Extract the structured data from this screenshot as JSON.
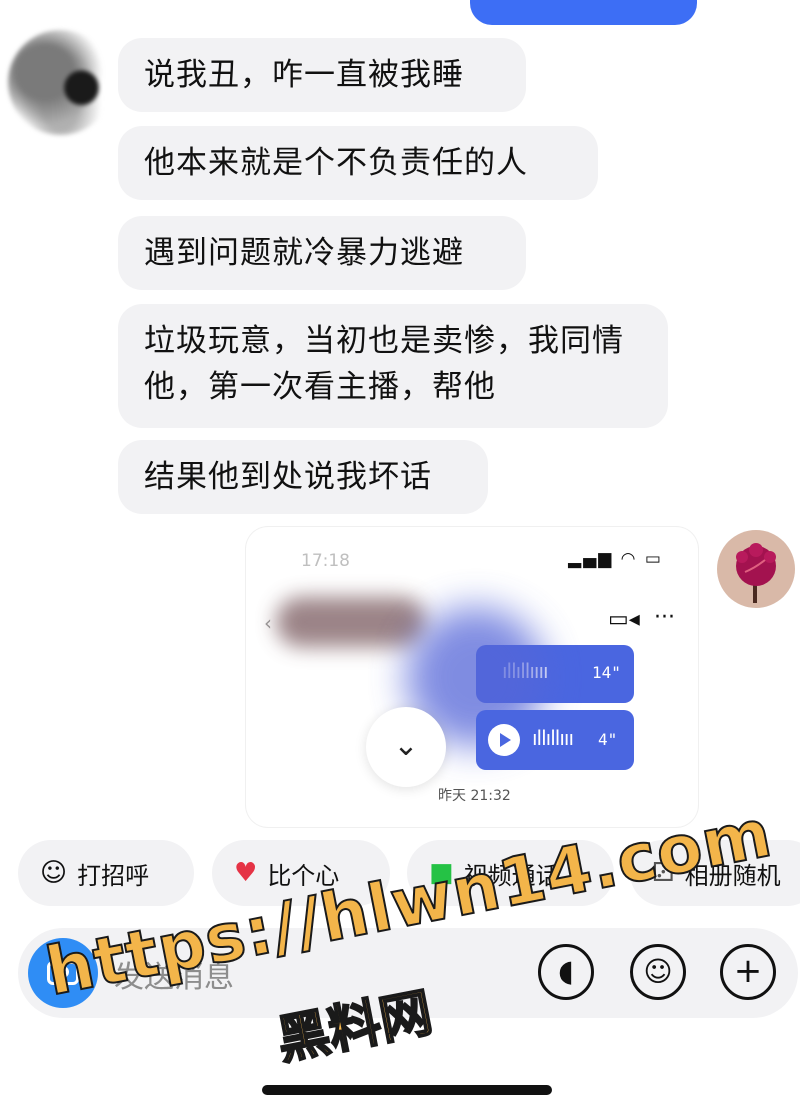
{
  "messages": [
    {
      "text": "说我丑，咋一直被我睡"
    },
    {
      "text": "他本来就是个不负责任的人"
    },
    {
      "text": "遇到问题就冷暴力逃避"
    },
    {
      "text": "垃圾玩意，当初也是卖惨，我同情他，第一次看主播，帮他"
    },
    {
      "text": "结果他到处说我坏话"
    }
  ],
  "embedded_screenshot": {
    "status_time": "17:18",
    "voice_messages": [
      {
        "duration": "14\""
      },
      {
        "duration": "4\""
      }
    ],
    "timestamp": "昨天 21:32"
  },
  "quick_actions": [
    {
      "label": "打招呼",
      "icon": "wave-hand-emoji"
    },
    {
      "label": "比个心",
      "icon": "heart-emoji"
    },
    {
      "label": "视频通话",
      "icon": "video-camera-icon"
    },
    {
      "label": "相册随机",
      "icon": "dice-emoji"
    }
  ],
  "input": {
    "placeholder": "发送消息"
  },
  "watermark": {
    "line1": "https://hlwn14.com",
    "line2": "黑料网"
  },
  "colors": {
    "accent_blue": "#3d6ef5",
    "bubble_gray": "#f2f2f4",
    "camera_blue": "#2f8df5",
    "watermark_orange": "#f3b54a"
  }
}
